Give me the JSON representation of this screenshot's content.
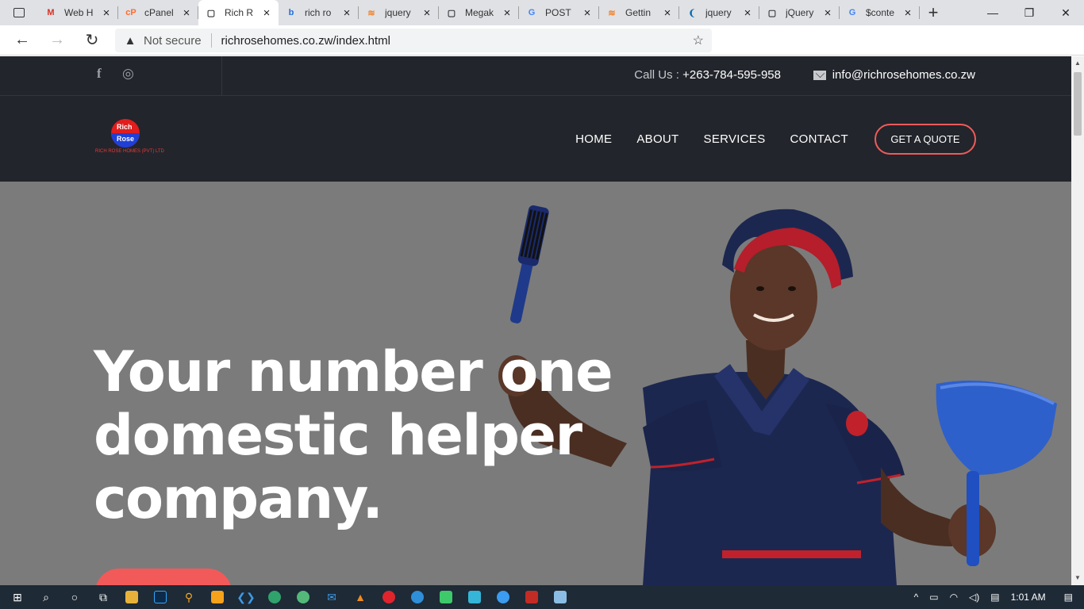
{
  "browser": {
    "tabs": [
      {
        "title": "Web H",
        "favicon": "gmail-icon",
        "color": "#d93025",
        "glyph": "M"
      },
      {
        "title": "cPanel",
        "favicon": "cpanel-icon",
        "color": "#ff6c2c",
        "glyph": "cP"
      },
      {
        "title": "Rich R",
        "favicon": "page-icon",
        "color": "#333333",
        "glyph": "▢",
        "active": true
      },
      {
        "title": "rich ro",
        "favicon": "bing-icon",
        "color": "#1e6fd9",
        "glyph": "b"
      },
      {
        "title": "jquery",
        "favicon": "stackoverflow-icon",
        "color": "#f48024",
        "glyph": "≋"
      },
      {
        "title": "Megak",
        "favicon": "page-icon",
        "color": "#333333",
        "glyph": "▢"
      },
      {
        "title": "POST",
        "favicon": "google-icon",
        "color": "#4285f4",
        "glyph": "G"
      },
      {
        "title": "Gettin",
        "favicon": "stackoverflow-icon",
        "color": "#f48024",
        "glyph": "≋"
      },
      {
        "title": "jquery",
        "favicon": "jquery-icon",
        "color": "#0769ad",
        "glyph": "❨"
      },
      {
        "title": "jQuery",
        "favicon": "page-icon",
        "color": "#333333",
        "glyph": "▢"
      },
      {
        "title": "$conte",
        "favicon": "google-icon",
        "color": "#4285f4",
        "glyph": "G"
      }
    ],
    "address": {
      "security": "Not secure",
      "url": "richrosehomes.co.zw/index.html"
    }
  },
  "site": {
    "topbar": {
      "call_label": "Call Us : ",
      "phone": "+263-784-595-958",
      "email": "info@richrosehomes.co.zw"
    },
    "logo": {
      "line1": "Rich",
      "line2": "Rose",
      "line3": "RICH ROSE HOMES (PVT) LTD"
    },
    "nav": {
      "home": "HOME",
      "about": "ABOUT",
      "services": "SERVICES",
      "contact": "CONTACT",
      "quote": "GET A QUOTE"
    },
    "hero": {
      "headline": "Your number one domestic helper company."
    }
  },
  "taskbar": {
    "time": "1:01 AM"
  },
  "colors": {
    "accent": "#f25a5a",
    "dark": "#22252b",
    "hero_bg": "#7b7b7b"
  }
}
